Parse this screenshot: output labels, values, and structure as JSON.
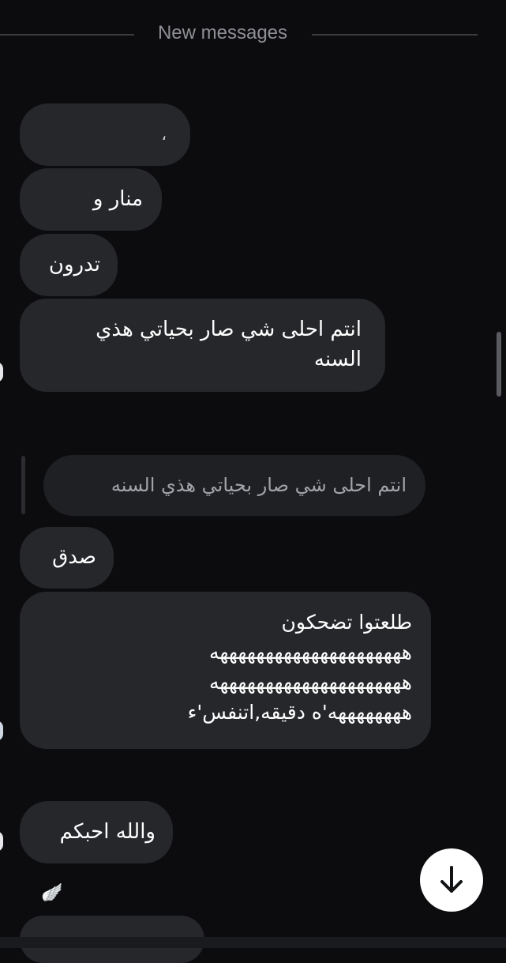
{
  "divider": {
    "label": "New messages"
  },
  "messages": [
    {
      "text": "،"
    },
    {
      "text": "منار و"
    },
    {
      "text": "تدرون"
    },
    {
      "lines": [
        "انتم احلى شي صار بحياتي هذي",
        "السنه"
      ]
    },
    {
      "text": "صدق"
    },
    {
      "lines": [
        "طلعتوا تضحكون",
        "هههههههههههههههههههههه",
        "هههههههههههههههههههههه",
        "ههههههههه'ه دقيقه,اتنفس'ء"
      ]
    },
    {
      "text": "والله احبكم"
    }
  ],
  "reply": {
    "text": "انتم احلى شي صار بحياتي هذي السنه"
  },
  "decorations": {
    "wing_icon": "🪽"
  },
  "scroll_button": {
    "icon": "arrow-down-icon"
  },
  "colors": {
    "background": "#0c0c0e",
    "bubble": "#26272b",
    "muted_text": "#8e9096"
  }
}
